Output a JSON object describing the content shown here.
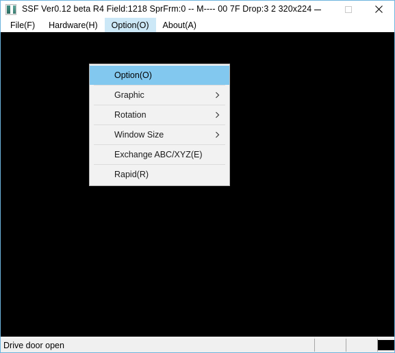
{
  "window": {
    "title": "SSF Ver0.12 beta R4  Field:1218  SprFrm:0  -- M----  00 7F  Drop:3  2  320x224",
    "icon_name": "ssf-app-icon",
    "accent_color": "#6cb3dd",
    "menu_highlight_color": "#82c8ef",
    "menubar_highlight_color": "#cce8f7",
    "client_background": "#000000"
  },
  "title_info": {
    "app_name": "SSF",
    "version": "Ver0.12 beta R4",
    "field": "Field:1218",
    "sprfrm": "SprFrm:0",
    "marker": "-- M----",
    "hex": "00 7F",
    "drop": "Drop:3",
    "counter": "2",
    "resolution": "320x224"
  },
  "window_controls": [
    {
      "name": "minimize-button",
      "label": "–"
    },
    {
      "name": "maximize-button",
      "label": "□"
    },
    {
      "name": "close-button",
      "label": "✕"
    }
  ],
  "menubar": {
    "items": [
      {
        "label": "File(F)",
        "active": false
      },
      {
        "label": "Hardware(H)",
        "active": false
      },
      {
        "label": "Option(O)",
        "active": true
      },
      {
        "label": "About(A)",
        "active": false
      }
    ]
  },
  "dropdown": {
    "open_for": "Option(O)",
    "items": [
      {
        "label": "Option(O)",
        "selected": true,
        "submenu": false
      },
      {
        "label": "Graphic",
        "selected": false,
        "submenu": true
      },
      {
        "label": "Rotation",
        "selected": false,
        "submenu": true
      },
      {
        "label": "Window Size",
        "selected": false,
        "submenu": true
      },
      {
        "label": "Exchange ABC/XYZ(E)",
        "selected": false,
        "submenu": false
      },
      {
        "label": "Rapid(R)",
        "selected": false,
        "submenu": false
      }
    ]
  },
  "status_bar": {
    "message": "Drive door open",
    "pane2": "",
    "pane3": "",
    "indicator_color": "#000000"
  }
}
